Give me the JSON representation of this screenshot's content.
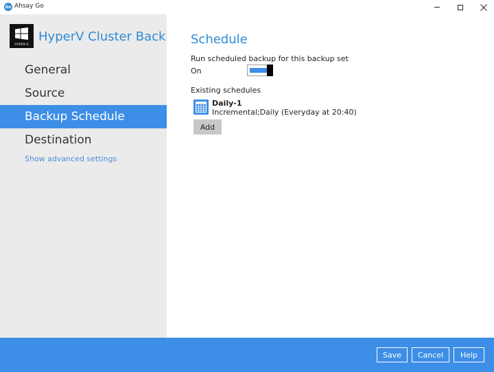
{
  "window": {
    "app_icon_text": "Go",
    "title": "Ahsay Go"
  },
  "sidebar": {
    "logo_text": "HYPER-V",
    "backup_set_name": "HyperV Cluster Back...",
    "items": [
      {
        "label": "General",
        "active": false
      },
      {
        "label": "Source",
        "active": false
      },
      {
        "label": "Backup Schedule",
        "active": true
      },
      {
        "label": "Destination",
        "active": false
      }
    ],
    "advanced_link": "Show advanced settings"
  },
  "main": {
    "title": "Schedule",
    "run_scheduled_label": "Run scheduled backup for this backup set",
    "toggle_state": "On",
    "existing_label": "Existing schedules",
    "schedules": [
      {
        "name": "Daily-1",
        "description": "Incremental;Daily (Everyday at 20:40)"
      }
    ],
    "add_label": "Add"
  },
  "footer": {
    "save_label": "Save",
    "cancel_label": "Cancel",
    "help_label": "Help"
  },
  "colors": {
    "accent": "#3d8ee6",
    "title_blue": "#2e8bd6",
    "sidebar_bg": "#ebebeb"
  }
}
